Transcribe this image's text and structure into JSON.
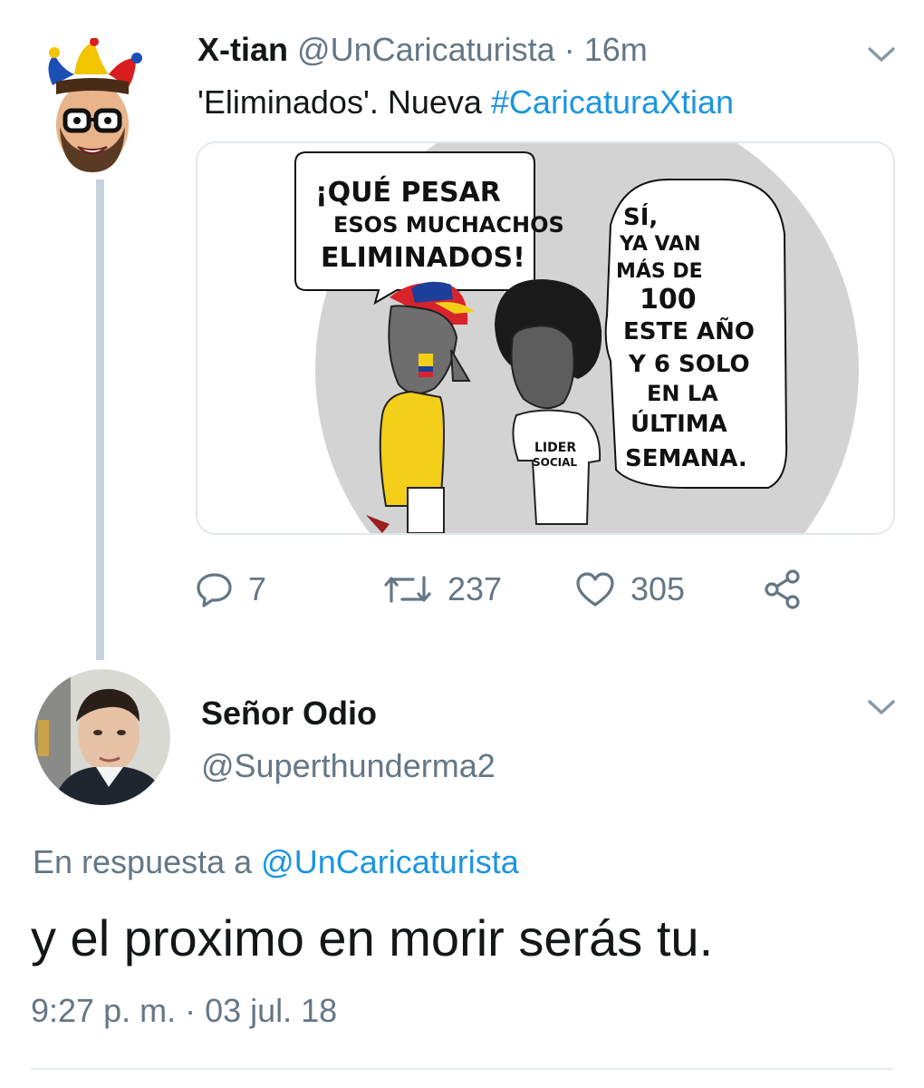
{
  "tweet": {
    "author_name": "X-tian",
    "author_handle": "@UnCaricaturista",
    "separator": "·",
    "time_ago": "16m",
    "text_prefix": "'Eliminados'. Nueva ",
    "hashtag": "#CaricaturaXtian",
    "media": {
      "speech_left": [
        "¡QUÉ PESAR",
        "ESOS MUCHACHOS",
        "ELIMINADOS!"
      ],
      "speech_right": [
        "SÍ,",
        "YA VAN",
        "MÁS DE",
        "100",
        "ESTE AÑO",
        "Y 6 SOLO",
        "EN LA",
        "ÚLTIMA",
        "SEMANA."
      ],
      "shirt_label": [
        "LIDER",
        "SOCIAL"
      ]
    },
    "actions": {
      "reply_count": "7",
      "retweet_count": "237",
      "like_count": "305"
    },
    "icons": {
      "menu": "chevron-down-icon",
      "reply": "reply-icon",
      "retweet": "retweet-icon",
      "like": "heart-icon",
      "share": "share-icon"
    }
  },
  "reply": {
    "author_name": "Señor Odio",
    "author_handle": "@Superthunderma2",
    "in_reply_prefix": "En respuesta a ",
    "in_reply_mention": "@UnCaricaturista",
    "text": "y el proximo en morir serás tu.",
    "timestamp": "9:27 p. m. · 03 jul. 18"
  },
  "colors": {
    "link": "#1b95e0",
    "muted": "#657786",
    "thread_line": "#c7d3dc"
  }
}
